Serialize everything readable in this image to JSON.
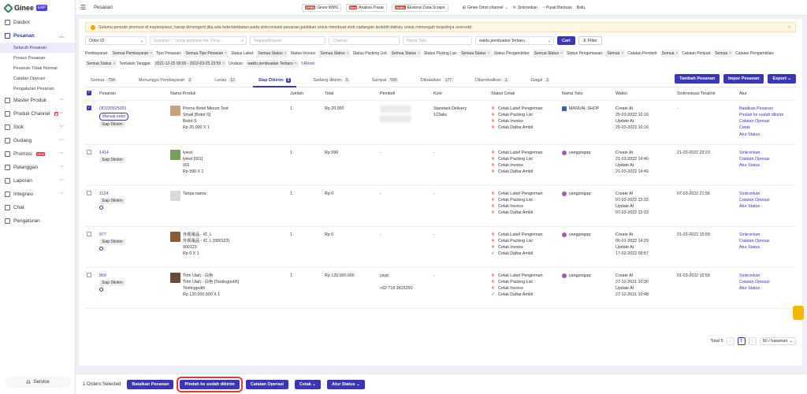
{
  "brand": {
    "name": "Ginee",
    "tag": "ERP"
  },
  "sidebar": {
    "items": [
      {
        "label": "Dasbor"
      },
      {
        "label": "Pesanan"
      },
      {
        "label": "Master Produk"
      },
      {
        "label": "Produk Channel"
      },
      {
        "label": "Stok"
      },
      {
        "label": "Gudang"
      },
      {
        "label": "Promosi"
      },
      {
        "label": "Pelanggan"
      },
      {
        "label": "Laporan"
      },
      {
        "label": "Integrasi"
      },
      {
        "label": "Chat"
      },
      {
        "label": "Pengaturan"
      }
    ],
    "subitems": [
      "Seluruh Pesanan",
      "Proses Pesanan",
      "Pesanan Tidak Normal",
      "Catatan Operasi",
      "Pengaturan Pesanan"
    ],
    "new_badge": "NEW",
    "service": "Service"
  },
  "topbar": {
    "breadcrumb": "Pesanan",
    "wms_tag": "OPEN",
    "wms": "Ginee WMS",
    "analisis_tag": "New",
    "analisis": "Analisis Pasar",
    "scrape_tag": "Gratis",
    "scrape": "Ekstensi Data Scrape",
    "omni": "Ginee Omni channel",
    "sync": "Sinkronkan",
    "help": "Pusat Bantuan",
    "user": "Bafu"
  },
  "notice": "Selama periode promosi di marketplace, harap dimengerti jika ada keterlambatan pada sinkronisasi pesanan,pastikan untuk membuat stok cadangan terlebih dahulu untuk mencegah terjadinya oversold",
  "filters": {
    "order_id": "Order ID",
    "search_ph": "Gunakan \",\" untuk pisahkan No. Pesa...",
    "region_ph": "Negara/Wilayah",
    "channel_ph": "Channel",
    "store_ph": "Nama Toko",
    "sort": "waktu pembuatan Terbaru",
    "search_btn": "Cari",
    "filter_btn": "Filter"
  },
  "chips": [
    {
      "label": "Pembayaran:",
      "val": "Semua Pembayaran"
    },
    {
      "label": "Tipe Pesanan:",
      "val": "Semua Tipe Pesanan"
    },
    {
      "label": "Status Label:",
      "val": "Semua Status"
    },
    {
      "label": "Status Invoice:",
      "val": "Semua Status"
    },
    {
      "label": "Status Packing List:",
      "val": "Semua Status"
    },
    {
      "label": "Status Picking List:",
      "val": "Semua Status"
    },
    {
      "label": "Status Pengambilan:",
      "val": "Semua Status"
    },
    {
      "label": "Status Pengemasan:",
      "val": "Semua"
    },
    {
      "label": "Catatan Pembeli:",
      "val": "Semua"
    },
    {
      "label": "Catatan Penjual:",
      "val": "Semua"
    },
    {
      "label": "Catatan Pengambilan:",
      "val": "Semua Status"
    },
    {
      "label": "Tentukan Tanggal:",
      "val": "2021-12-25 00:00 - 2022-03-25 23:59"
    },
    {
      "label": "Urutkan:",
      "val": "waktu pembuatan Terbaru"
    }
  ],
  "reset": "Reset",
  "tabs": [
    {
      "label": "Semua",
      "count": "794"
    },
    {
      "label": "Menunggu Pembayaran",
      "count": "2"
    },
    {
      "label": "Lunas",
      "count": "12"
    },
    {
      "label": "Siap Dikirim",
      "count": "5"
    },
    {
      "label": "Sedang dikirim",
      "count": "5"
    },
    {
      "label": "Sampai",
      "count": "590"
    },
    {
      "label": "Dibatalkan",
      "count": "177"
    },
    {
      "label": "Dikembalikan",
      "count": "1"
    },
    {
      "label": "Gagal",
      "count": "2"
    }
  ],
  "tab_buttons": {
    "add": "Tambah Pesanan",
    "import": "Impor Pesanan",
    "export": "Export"
  },
  "columns": [
    "Pesanan",
    "Nama Produk",
    "Jumlah",
    "Total",
    "Pembeli",
    "Kurir",
    "Status Cetak",
    "Nama Toko",
    "Waktu",
    "Sinkronisasi Terakhir",
    "Atur"
  ],
  "print_labels": [
    "Cetak Label Pengiriman",
    "Cetak Packing List",
    "Cetak Invoice",
    "Cetak Daftar Ambil"
  ],
  "rows": [
    {
      "id": "OD220325001",
      "tag": "Manual order",
      "status": "Siap Dikirim",
      "pname": "Promo Botol Minum Test",
      "pvar": "Small [Botol-S]",
      "psku": "Botol-S",
      "pprice": "Rp 20.000 X 1",
      "qty": "1",
      "total": "Rp 20.000",
      "buyer": "",
      "buyer2": "",
      "courier": "Standard Delivery",
      "courier2": "123abc",
      "store": "MANUAL SHOP",
      "c_label": "Create At",
      "created": "25-03-2022 10:16",
      "u_label": "Update At",
      "updated": "25-03-2022 10:16",
      "sync": "-",
      "actions": [
        "Batalkan Pesanan",
        "Pindah ke sudah dikirim",
        "Catatan Operasi",
        "Cetak",
        "Atur Status"
      ]
    },
    {
      "id": "1414",
      "tag": "",
      "status": "Siap Dikirim",
      "pname": "lyiest",
      "pvar": "lyiest [001]",
      "psku": "001",
      "pprice": "Rp 990 X 1",
      "qty": "1",
      "total": "Rp 990",
      "buyer": "-",
      "buyer2": "",
      "courier": "-",
      "courier2": "",
      "store": "yangpingqq",
      "c_label": "Create At",
      "created": "21-03-2022 14:46",
      "u_label": "Update At",
      "updated": "21-03-2022 14:49",
      "sync": "21-03-2022 23:23",
      "actions": [
        "Sinkronkan",
        "Catatan Operasi",
        "Atur Status"
      ]
    },
    {
      "id": "1124",
      "tag": "",
      "status": "Siap Dikirim",
      "pname": "Tanpa nama",
      "pvar": "",
      "psku": "",
      "pprice": "",
      "qty": "1",
      "total": "Rp 0",
      "buyer": "-",
      "buyer2": "",
      "courier": "-",
      "courier2": "",
      "store": "yangpingqq",
      "c_label": "Create At",
      "created": "07-03-2022 13:32",
      "u_label": "Update At",
      "updated": "07-03-2022 13:33",
      "sync": "07-03-2022 21:56",
      "actions": [
        "Sinkronkan",
        "Catatan Operasi",
        "Atur Status"
      ]
    },
    {
      "id": "877",
      "tag": "",
      "status": "Siap Dikirim",
      "pname": "外观電品 - 红, L",
      "pvar": "外观電品 - 红, L [000123]",
      "psku": "000123",
      "pprice": "Rp 0 X 1",
      "qty": "1",
      "total": "Rp 0",
      "buyer": "-",
      "buyer2": "",
      "courier": "-",
      "courier2": "",
      "store": "yangpingqq",
      "c_label": "Create At",
      "created": "06-01-2022 14:29",
      "u_label": "Update At",
      "updated": "17-02-2022 09:57",
      "sync": "01-03-2022 15:59",
      "actions": [
        "Sinkronkan",
        "Catatan Operasi",
        "Atur Status"
      ]
    },
    {
      "id": "869",
      "tag": "",
      "status": "Siap Dikirim",
      "pname": "Trim Utah - 白色",
      "pvar": "Trim Utah - 白色 [Testingputih]",
      "psku": "Testingputih",
      "pprice": "Rp 120.000.000 X 1",
      "qty": "1",
      "total": "Rp 120.000.000",
      "buyer": "yayp",
      "buyer2": "+62 718 3415250",
      "courier": "-",
      "courier2": "",
      "store": "yangpingqq",
      "c_label": "Create At",
      "created": "27-12-2021 10:30",
      "u_label": "Update At",
      "updated": "27-12-2021 10:48",
      "sync": "01-03-2022 15:59",
      "actions": [
        "Sinkronkan",
        "Catatan Operasi",
        "Atur Status"
      ]
    }
  ],
  "print_status": [
    [
      "x",
      "x",
      "x",
      "x"
    ],
    [
      "x",
      "x",
      "x",
      "x"
    ],
    [
      "x",
      "x",
      "x",
      "x"
    ],
    [
      "x",
      "x",
      "x",
      "ok"
    ],
    [
      "x",
      "x",
      "x",
      "ok"
    ]
  ],
  "pager": {
    "total": "Total 5",
    "page": "1",
    "size": "50 / halaman"
  },
  "bottom": {
    "selected": "1 Orders Selected",
    "cancel": "Batalkan Pesanan",
    "move": "Pindah ke sudah dikirim",
    "notes": "Catatan Operasi",
    "print": "Cetak",
    "status": "Atur Status"
  }
}
